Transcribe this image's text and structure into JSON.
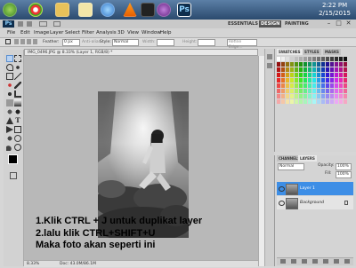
{
  "taskbar": {
    "icons": [
      "start-orb",
      "chrome",
      "explorer",
      "file-manager",
      "ie",
      "vlc",
      "bbm",
      "messenger",
      "photoshop"
    ],
    "clock_time": "2:22 PM",
    "clock_date": "2/15/2015"
  },
  "app": {
    "logo": "Ps",
    "workspaces": [
      "ESSENTIALS",
      "DESIGN",
      "PAINTING"
    ],
    "window_buttons": [
      "–",
      "□",
      "✕"
    ]
  },
  "menubar": [
    "File",
    "Edit",
    "Image",
    "Layer",
    "Select",
    "Filter",
    "Analysis",
    "3D",
    "View",
    "Window",
    "Help"
  ],
  "options": {
    "feather_label": "Feather:",
    "feather_value": "0 px",
    "antialias": "Anti-alias",
    "style_label": "Style:",
    "style_value": "Normal",
    "width_label": "Width:",
    "height_label": "Height:",
    "refine_edge": "Refine Edge..."
  },
  "document": {
    "tab_title": "IMG_0496.JPG @ 8.33% (Layer 1, RGB/8) *",
    "zoom": "8.33%",
    "doc_size": "Doc: 43.0M/86.1M"
  },
  "caption": {
    "line1": "1.Klik CTRL + J untuk duplikat layer",
    "line2": "2.lalu klik CTRL+SHIFT+U",
    "line3": "Maka foto akan seperti ini"
  },
  "panels": {
    "swatch_tabs": [
      "SWATCHES",
      "STYLES",
      "MASKS"
    ],
    "layer_tabs": [
      "CHANNELS",
      "LAYERS"
    ],
    "blend_mode": "Normal",
    "opacity_label": "Opacity:",
    "opacity_value": "100%",
    "fill_label": "Fill:",
    "fill_value": "100%",
    "layers": [
      {
        "name": "Layer 1",
        "selected": true
      },
      {
        "name": "Background",
        "selected": false
      }
    ]
  },
  "colors": {
    "accent_selected_layer": "#3d8ee6",
    "design_tab": "#555555"
  }
}
